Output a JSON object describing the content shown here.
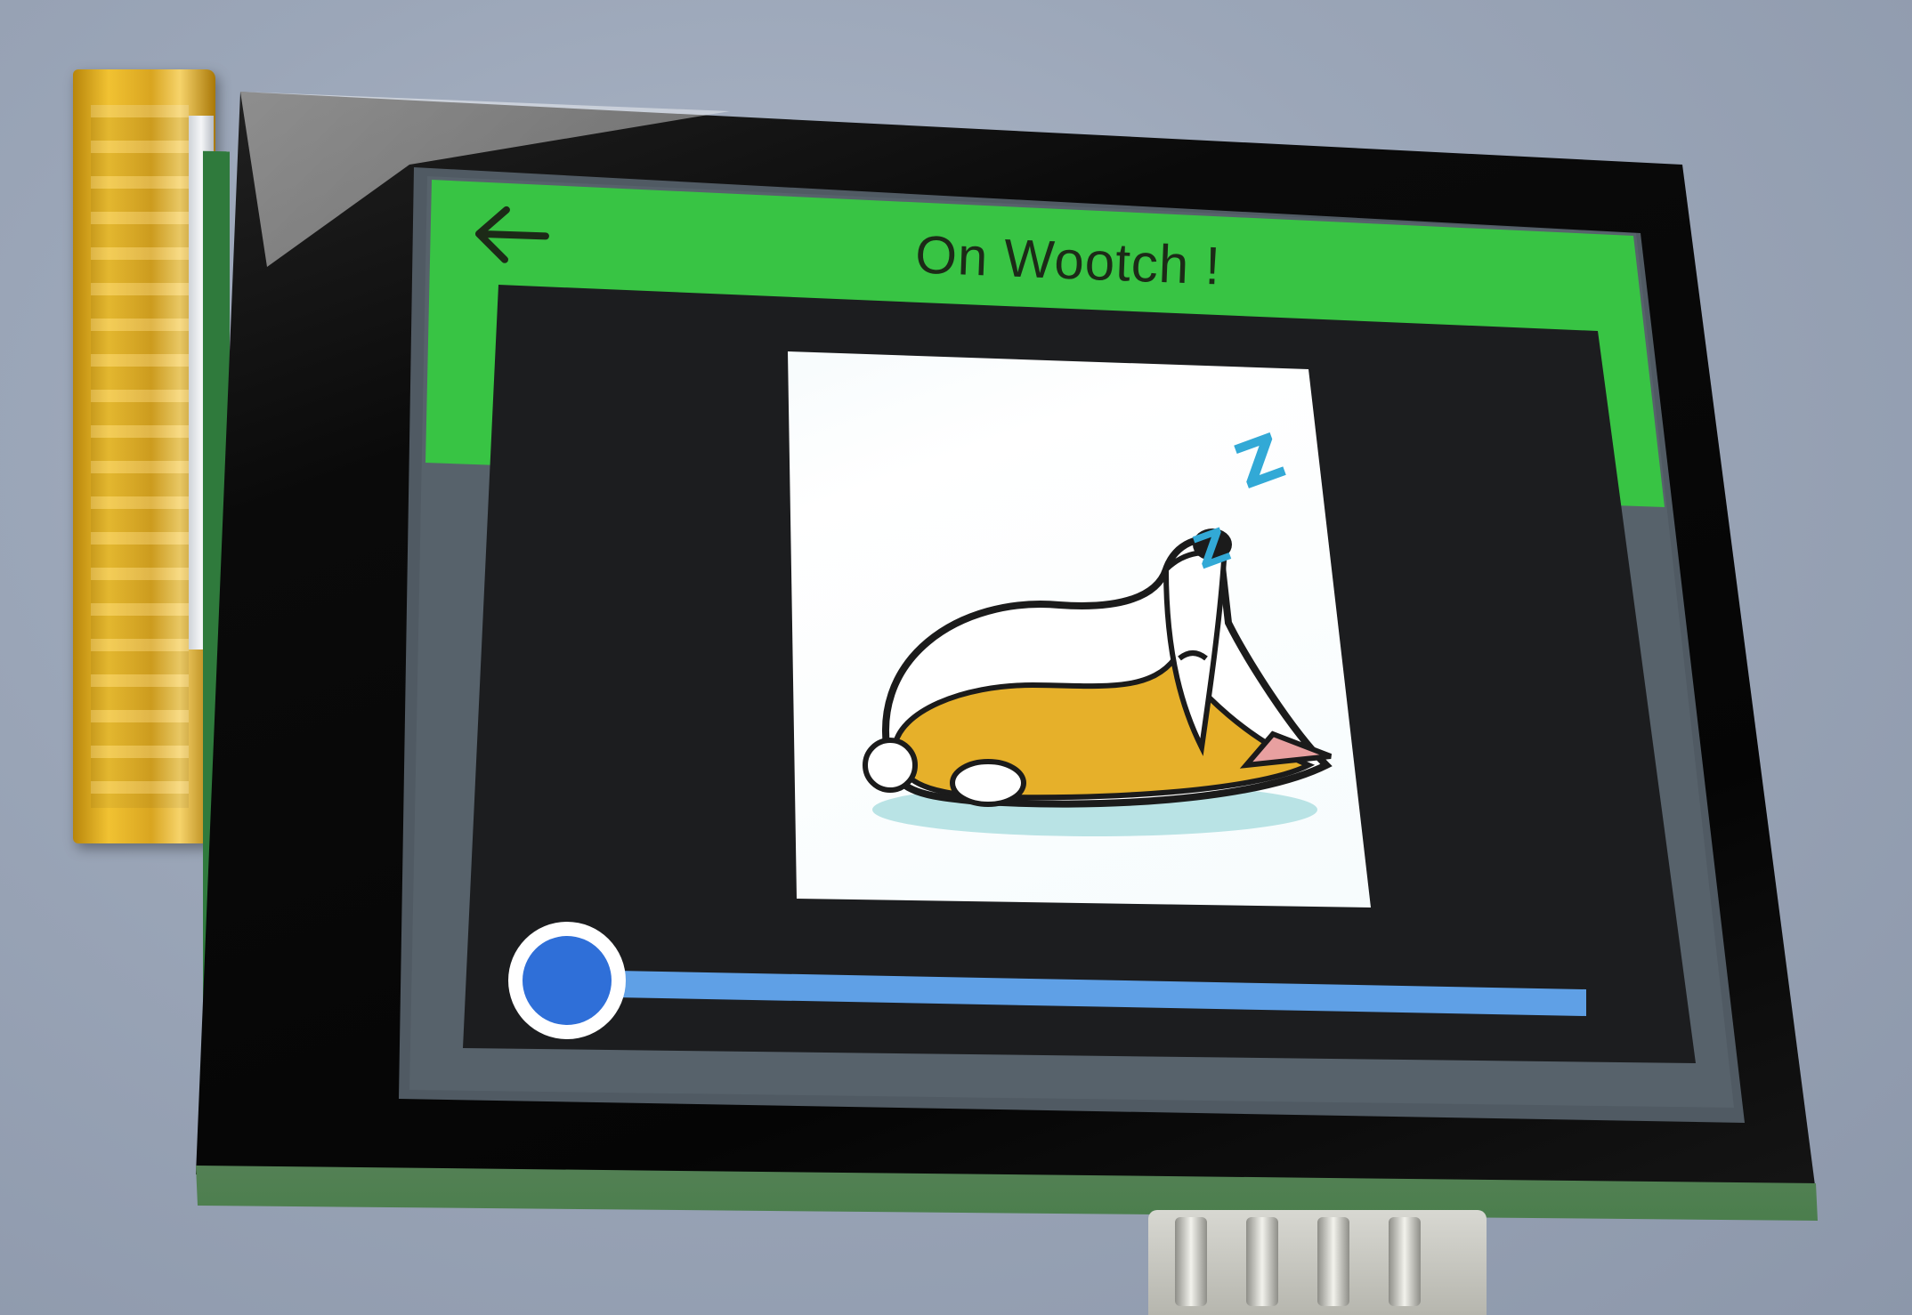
{
  "screen": {
    "title": "On Wootch !",
    "back_icon": "arrow-left-icon",
    "image_subject": "sleeping-corgi-icon",
    "slider_fraction": 0.0
  },
  "colors": {
    "header_green": "#38c444",
    "slider_blue": "#2f6fd8",
    "track_blue": "#5fa0e6"
  }
}
